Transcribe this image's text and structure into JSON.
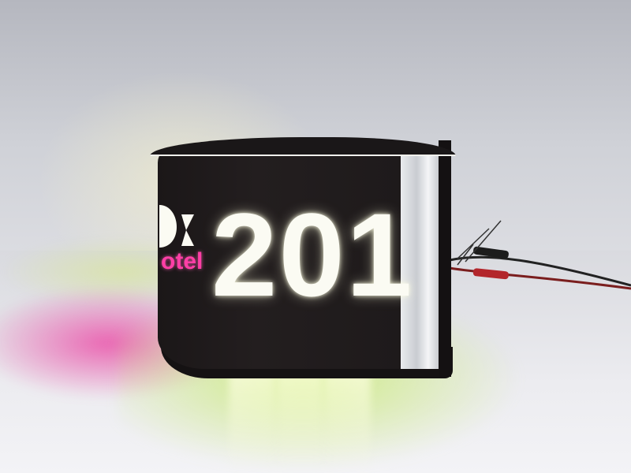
{
  "sign": {
    "room_number": "201",
    "logo_text": "otel",
    "logo_color": "#ff3fa6",
    "number_color": "#fbfbf3",
    "panel_color": "#1b1718"
  },
  "scene": {
    "glow_colors": [
      "#eb3ca0",
      "#c8eb6e"
    ]
  },
  "icons": [
    "hotel-logo-icon"
  ]
}
